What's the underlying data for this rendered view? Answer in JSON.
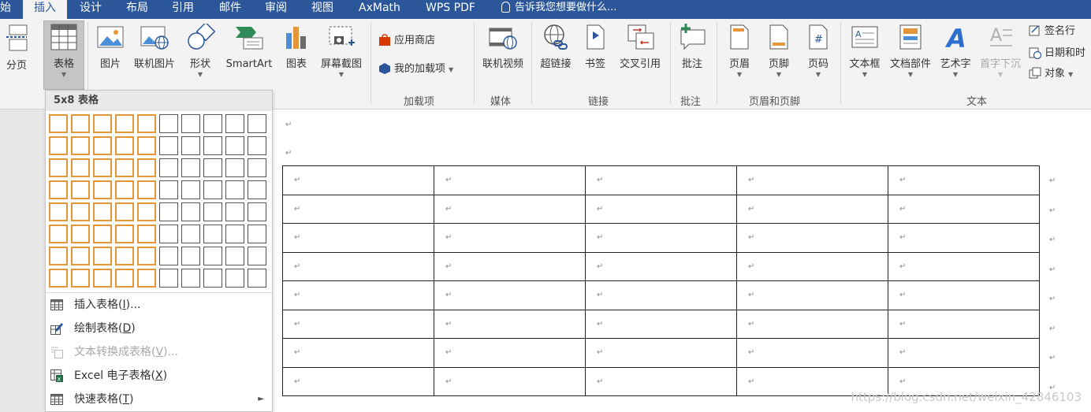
{
  "tabs": [
    {
      "label": "始",
      "active": false
    },
    {
      "label": "插入",
      "active": true
    },
    {
      "label": "设计",
      "active": false
    },
    {
      "label": "布局",
      "active": false
    },
    {
      "label": "引用",
      "active": false
    },
    {
      "label": "邮件",
      "active": false
    },
    {
      "label": "审阅",
      "active": false
    },
    {
      "label": "视图",
      "active": false
    },
    {
      "label": "AxMath",
      "active": false
    },
    {
      "label": "WPS PDF",
      "active": false
    }
  ],
  "tell_me": {
    "text": "告诉我您想要做什么..."
  },
  "ribbon": {
    "page_break": "分页",
    "table": "表格",
    "picture": "图片",
    "online_picture": "联机图片",
    "shapes": "形状",
    "smartart": "SmartArt",
    "chart": "图表",
    "screenshot": "屏幕截图",
    "store": "应用商店",
    "my_addins": "我的加载项",
    "group_addins": "加载项",
    "online_video": "联机视频",
    "group_media": "媒体",
    "hyperlink": "超链接",
    "bookmark": "书签",
    "cross_ref": "交叉引用",
    "group_links": "链接",
    "comment": "批注",
    "group_comments": "批注",
    "header": "页眉",
    "footer": "页脚",
    "page_number": "页码",
    "group_header_footer": "页眉和页脚",
    "textbox": "文本框",
    "quick_parts": "文档部件",
    "wordart": "艺术字",
    "drop_cap": "首字下沉",
    "signature_line": "签名行",
    "date_time": "日期和时",
    "object": "对象",
    "group_text": "文本"
  },
  "dropdown": {
    "header": "5x8 表格",
    "grid": {
      "cols": 10,
      "rows": 8,
      "selected_cols": 5,
      "selected_rows": 8
    },
    "items": [
      {
        "label": "插入表格(",
        "key": "I",
        "suffix": ")...",
        "disabled": false
      },
      {
        "label": "绘制表格(",
        "key": "D",
        "suffix": ")",
        "disabled": false
      },
      {
        "label": "文本转换成表格(",
        "key": "V",
        "suffix": ")...",
        "disabled": true
      },
      {
        "label": "Excel 电子表格(",
        "key": "X",
        "suffix": ")",
        "disabled": false
      },
      {
        "label": "快速表格(",
        "key": "T",
        "suffix": ")",
        "disabled": false
      }
    ]
  },
  "document": {
    "para_mark": "↵",
    "table": {
      "cols": 5,
      "rows": 8
    }
  },
  "watermark": "https://blog.csdn.net/weixin_42846103",
  "colors": {
    "tab_bar": "#2b579a",
    "selection": "#e6963a",
    "ribbon_bg": "#f3f3f3"
  }
}
